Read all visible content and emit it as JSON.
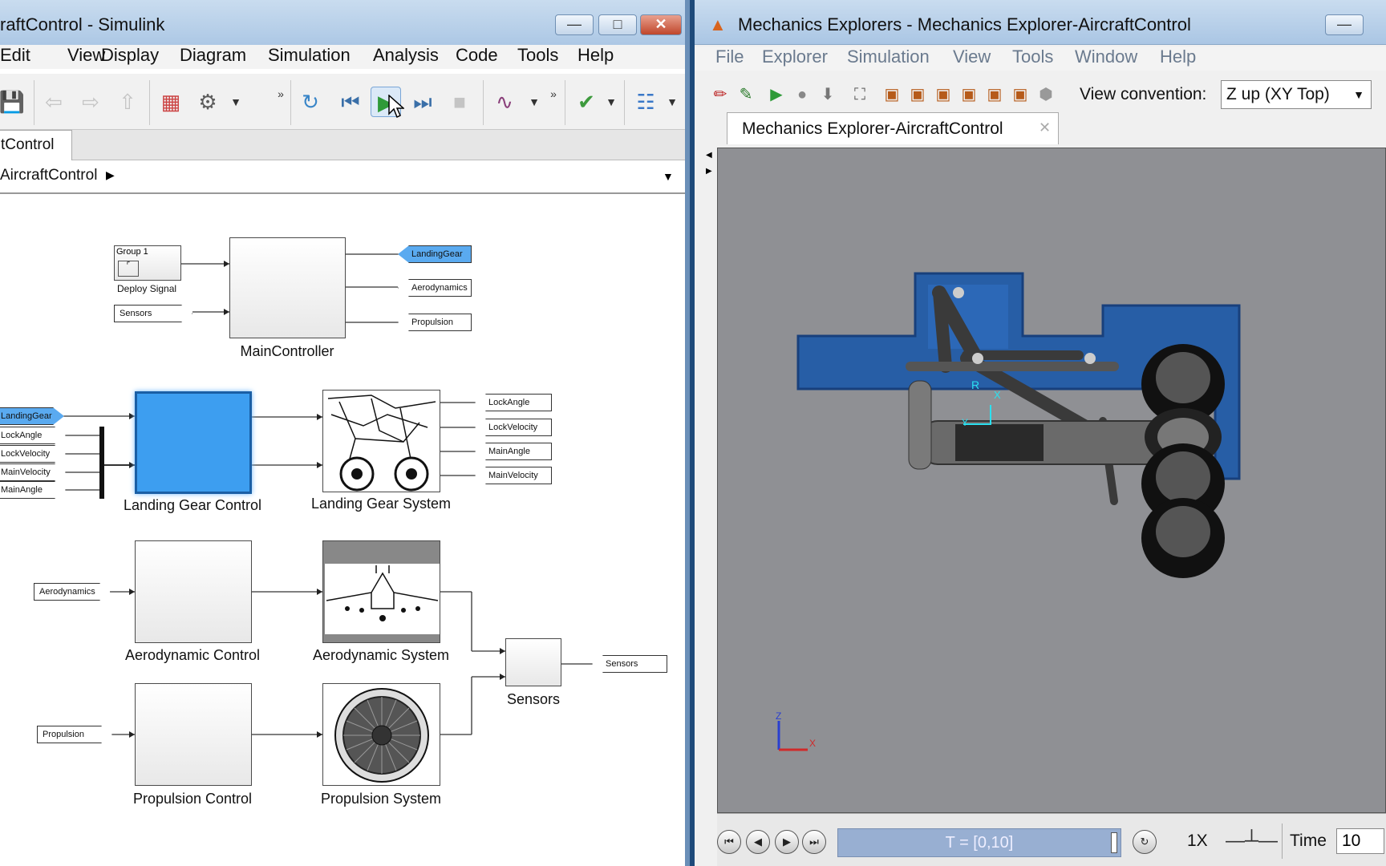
{
  "simulink": {
    "title": "raftControl - Simulink",
    "menu": [
      "Edit",
      "View",
      "Display",
      "Diagram",
      "Simulation",
      "Analysis",
      "Code",
      "Tools",
      "Help"
    ],
    "tab": "tControl",
    "breadcrumb": "AircraftControl",
    "blocks": {
      "group1": "Group 1",
      "deploy_signal": "Deploy Signal",
      "main_controller": "MainController",
      "landing_gear_control": "Landing Gear Control",
      "landing_gear_system": "Landing Gear System",
      "aerodynamic_control": "Aerodynamic Control",
      "aerodynamic_system": "Aerodynamic System",
      "sensors": "Sensors",
      "propulsion_control": "Propulsion Control",
      "propulsion_system": "Propulsion System"
    },
    "ports": {
      "sensors_in": "Sensors",
      "landinggear_out": "LandingGear",
      "aerodynamics_out": "Aerodynamics",
      "propulsion_out": "Propulsion",
      "landinggear_in": "LandingGear",
      "lockangle_in": "LockAngle",
      "lockvelocity_in": "LockVelocity",
      "mainvelocity_in": "MainVelocity",
      "mainangle_in": "MainAngle",
      "lockangle_out": "LockAngle",
      "lockvelocity_out": "LockVelocity",
      "mainangle_out": "MainAngle",
      "mainvelocity_out": "MainVelocity",
      "aerodynamics_in": "Aerodynamics",
      "sensors_out": "Sensors",
      "propulsion_in": "Propulsion"
    }
  },
  "mechanics": {
    "title": "Mechanics Explorers - Mechanics Explorer-AircraftControl",
    "menu": [
      "File",
      "Explorer",
      "Simulation",
      "View",
      "Tools",
      "Window",
      "Help"
    ],
    "view_convention_label": "View convention:",
    "view_convention_value": "Z up (XY Top)",
    "tab": "Mechanics Explorer-AircraftControl",
    "frame_labels": {
      "r": "R",
      "x": "X",
      "y": "Y"
    },
    "axis_labels": {
      "z": "Z",
      "x": "X"
    },
    "time_range": "T = [0,10]",
    "speed": "1X",
    "time_label": "Time",
    "time_value": "10"
  }
}
